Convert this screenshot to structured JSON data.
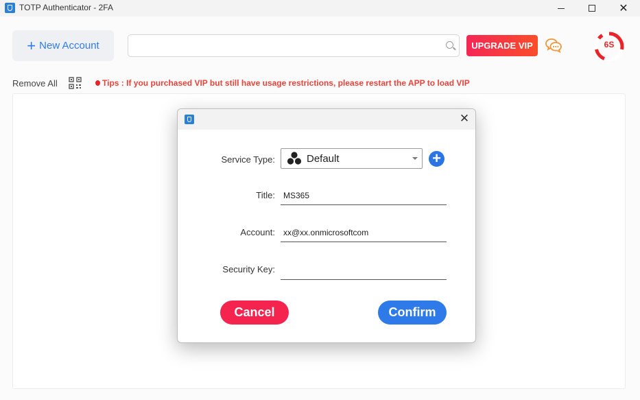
{
  "window": {
    "title": "TOTP Authenticator - 2FA",
    "minimize_glyph": "—",
    "maximize_glyph": "☐",
    "close_glyph": "✕"
  },
  "toolbar": {
    "new_account_label": "New Account",
    "new_account_icon": "plus-icon",
    "search_placeholder": "",
    "upgrade_label": "UPGRADE VIP",
    "timer_label": "6S",
    "timer_fraction_remaining": 0.2
  },
  "subbar": {
    "remove_all_label": "Remove All",
    "tips_text": "Tips : If you purchased VIP but still have usage restrictions, please restart the APP to load VIP"
  },
  "dialog": {
    "close_glyph": "✕",
    "service_type_label": "Service Type:",
    "service_type_value": "Default",
    "title_label": "Title:",
    "title_value": "MS365",
    "account_label": "Account:",
    "account_value": "xx@xx.onmicrosoftcom",
    "security_key_label": "Security Key:",
    "security_key_value": "",
    "add_type_glyph": "+",
    "cancel_label": "Cancel",
    "confirm_label": "Confirm"
  },
  "colors": {
    "accent_blue": "#2e7ae8",
    "cancel_red": "#f5244f",
    "upgrade_red": "#f52756",
    "tips_red": "#e8423a",
    "chat_orange": "#f0953a"
  }
}
